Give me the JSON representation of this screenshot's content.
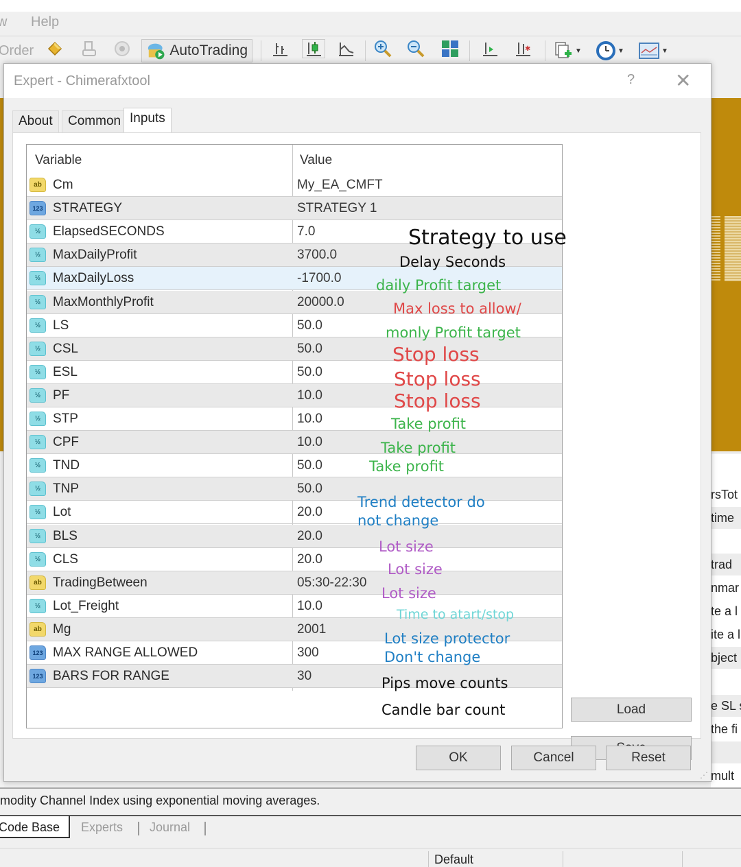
{
  "menubar": {
    "items": [
      "w",
      "Help"
    ]
  },
  "toolbar": {
    "new_order_label": "Order",
    "autotrading_label": "AutoTrading",
    "icons": [
      "metaeditor-icon",
      "navigator-icon",
      "signals-icon",
      "autotrading-icon",
      "bar-chart-icon",
      "candlestick-icon",
      "line-chart-icon",
      "zoom-in-icon",
      "zoom-out-icon",
      "tile-windows-icon",
      "chart-shift-icon",
      "autoscroll-icon",
      "new-chart-icon",
      "periods-icon",
      "templates-icon"
    ]
  },
  "dialog": {
    "title": "Expert - Chimerafxtool",
    "help_label": "?",
    "close_label": "✕",
    "tabs": [
      {
        "label": "About",
        "active": false
      },
      {
        "label": "Common",
        "active": false
      },
      {
        "label": "Inputs",
        "active": true
      }
    ],
    "grid": {
      "columns": [
        "Variable",
        "Value"
      ],
      "rows": [
        {
          "type": "string",
          "icon": "ab",
          "variable": "Cm",
          "value": "My_EA_CMFT"
        },
        {
          "type": "enum",
          "icon": "123",
          "variable": "STRATEGY",
          "value": "STRATEGY 1"
        },
        {
          "type": "double",
          "icon": "½",
          "variable": "ElapsedSECONDS",
          "value": "7.0"
        },
        {
          "type": "double",
          "icon": "½",
          "variable": "MaxDailyProfit",
          "value": "3700.0"
        },
        {
          "type": "double",
          "icon": "½",
          "variable": "MaxDailyLoss",
          "value": "-1700.0",
          "selected": true
        },
        {
          "type": "double",
          "icon": "½",
          "variable": "MaxMonthlyProfit",
          "value": "20000.0"
        },
        {
          "type": "double",
          "icon": "½",
          "variable": "LS",
          "value": "50.0"
        },
        {
          "type": "double",
          "icon": "½",
          "variable": "CSL",
          "value": "50.0"
        },
        {
          "type": "double",
          "icon": "½",
          "variable": "ESL",
          "value": "50.0"
        },
        {
          "type": "double",
          "icon": "½",
          "variable": "PF",
          "value": "10.0"
        },
        {
          "type": "double",
          "icon": "½",
          "variable": "STP",
          "value": "10.0"
        },
        {
          "type": "double",
          "icon": "½",
          "variable": "CPF",
          "value": "10.0"
        },
        {
          "type": "double",
          "icon": "½",
          "variable": "TND",
          "value": "50.0"
        },
        {
          "type": "double",
          "icon": "½",
          "variable": "TNP",
          "value": "50.0"
        },
        {
          "type": "double",
          "icon": "½",
          "variable": "Lot",
          "value": "20.0"
        },
        {
          "type": "double",
          "icon": "½",
          "variable": "BLS",
          "value": "20.0"
        },
        {
          "type": "double",
          "icon": "½",
          "variable": "CLS",
          "value": "20.0"
        },
        {
          "type": "string",
          "icon": "ab",
          "variable": "TradingBetween",
          "value": "05:30-22:30"
        },
        {
          "type": "double",
          "icon": "½",
          "variable": "Lot_Freight",
          "value": "10.0"
        },
        {
          "type": "string",
          "icon": "ab",
          "variable": "Mg",
          "value": "2001"
        },
        {
          "type": "enum",
          "icon": "123",
          "variable": "MAX RANGE ALLOWED",
          "value": "300"
        },
        {
          "type": "enum",
          "icon": "123",
          "variable": "BARS FOR RANGE",
          "value": "30"
        }
      ]
    },
    "annotations": [
      {
        "text": "Strategy to use",
        "color": "#111111"
      },
      {
        "text": "Delay Seconds",
        "color": "#111111"
      },
      {
        "text": "daily Profit target",
        "color": "#3cb44b"
      },
      {
        "text": "Max loss to allow/",
        "color": "#e04848"
      },
      {
        "text": "monly Profit target",
        "color": "#3cb44b"
      },
      {
        "text": "Stop loss",
        "color": "#e04848"
      },
      {
        "text": "Stop loss",
        "color": "#e04848"
      },
      {
        "text": "Stop loss",
        "color": "#e04848"
      },
      {
        "text": "Take profit",
        "color": "#3cb44b"
      },
      {
        "text": "Take profit",
        "color": "#3cb44b"
      },
      {
        "text": "Take profit",
        "color": "#3cb44b"
      },
      {
        "text": "Trend detector do",
        "color": "#1f7fc4"
      },
      {
        "text": "not change",
        "color": "#1f7fc4"
      },
      {
        "text": "Lot size",
        "color": "#b05cc6"
      },
      {
        "text": "Lot size",
        "color": "#b05cc6"
      },
      {
        "text": "Lot size",
        "color": "#b05cc6"
      },
      {
        "text": "Time to atart/stop",
        "color": "#6fd6d6"
      },
      {
        "text": "Lot size protector",
        "color": "#1f7fc4"
      },
      {
        "text": "Don't change",
        "color": "#1f7fc4"
      },
      {
        "text": "Pips move counts",
        "color": "#111111"
      },
      {
        "text": "Candle bar count",
        "color": "#111111"
      }
    ],
    "buttons": {
      "load": "Load",
      "save": "Save",
      "ok": "OK",
      "cancel": "Cancel",
      "reset": "Reset"
    }
  },
  "background": {
    "side_fragments": [
      "rsTot",
      "time",
      "",
      "trad",
      "nmar",
      "te a l",
      "ite a l",
      "bject",
      "",
      "e SL s",
      "the fi",
      "",
      "mult"
    ],
    "description": "modity Channel Index using exponential moving averages.",
    "bottom_tabs": [
      "Code Base",
      "Experts",
      "Journal"
    ],
    "status": {
      "profile": "Default"
    }
  },
  "colors": {
    "chart_gold": "#bf8a0c",
    "selected_row": "#e6f2fb"
  }
}
